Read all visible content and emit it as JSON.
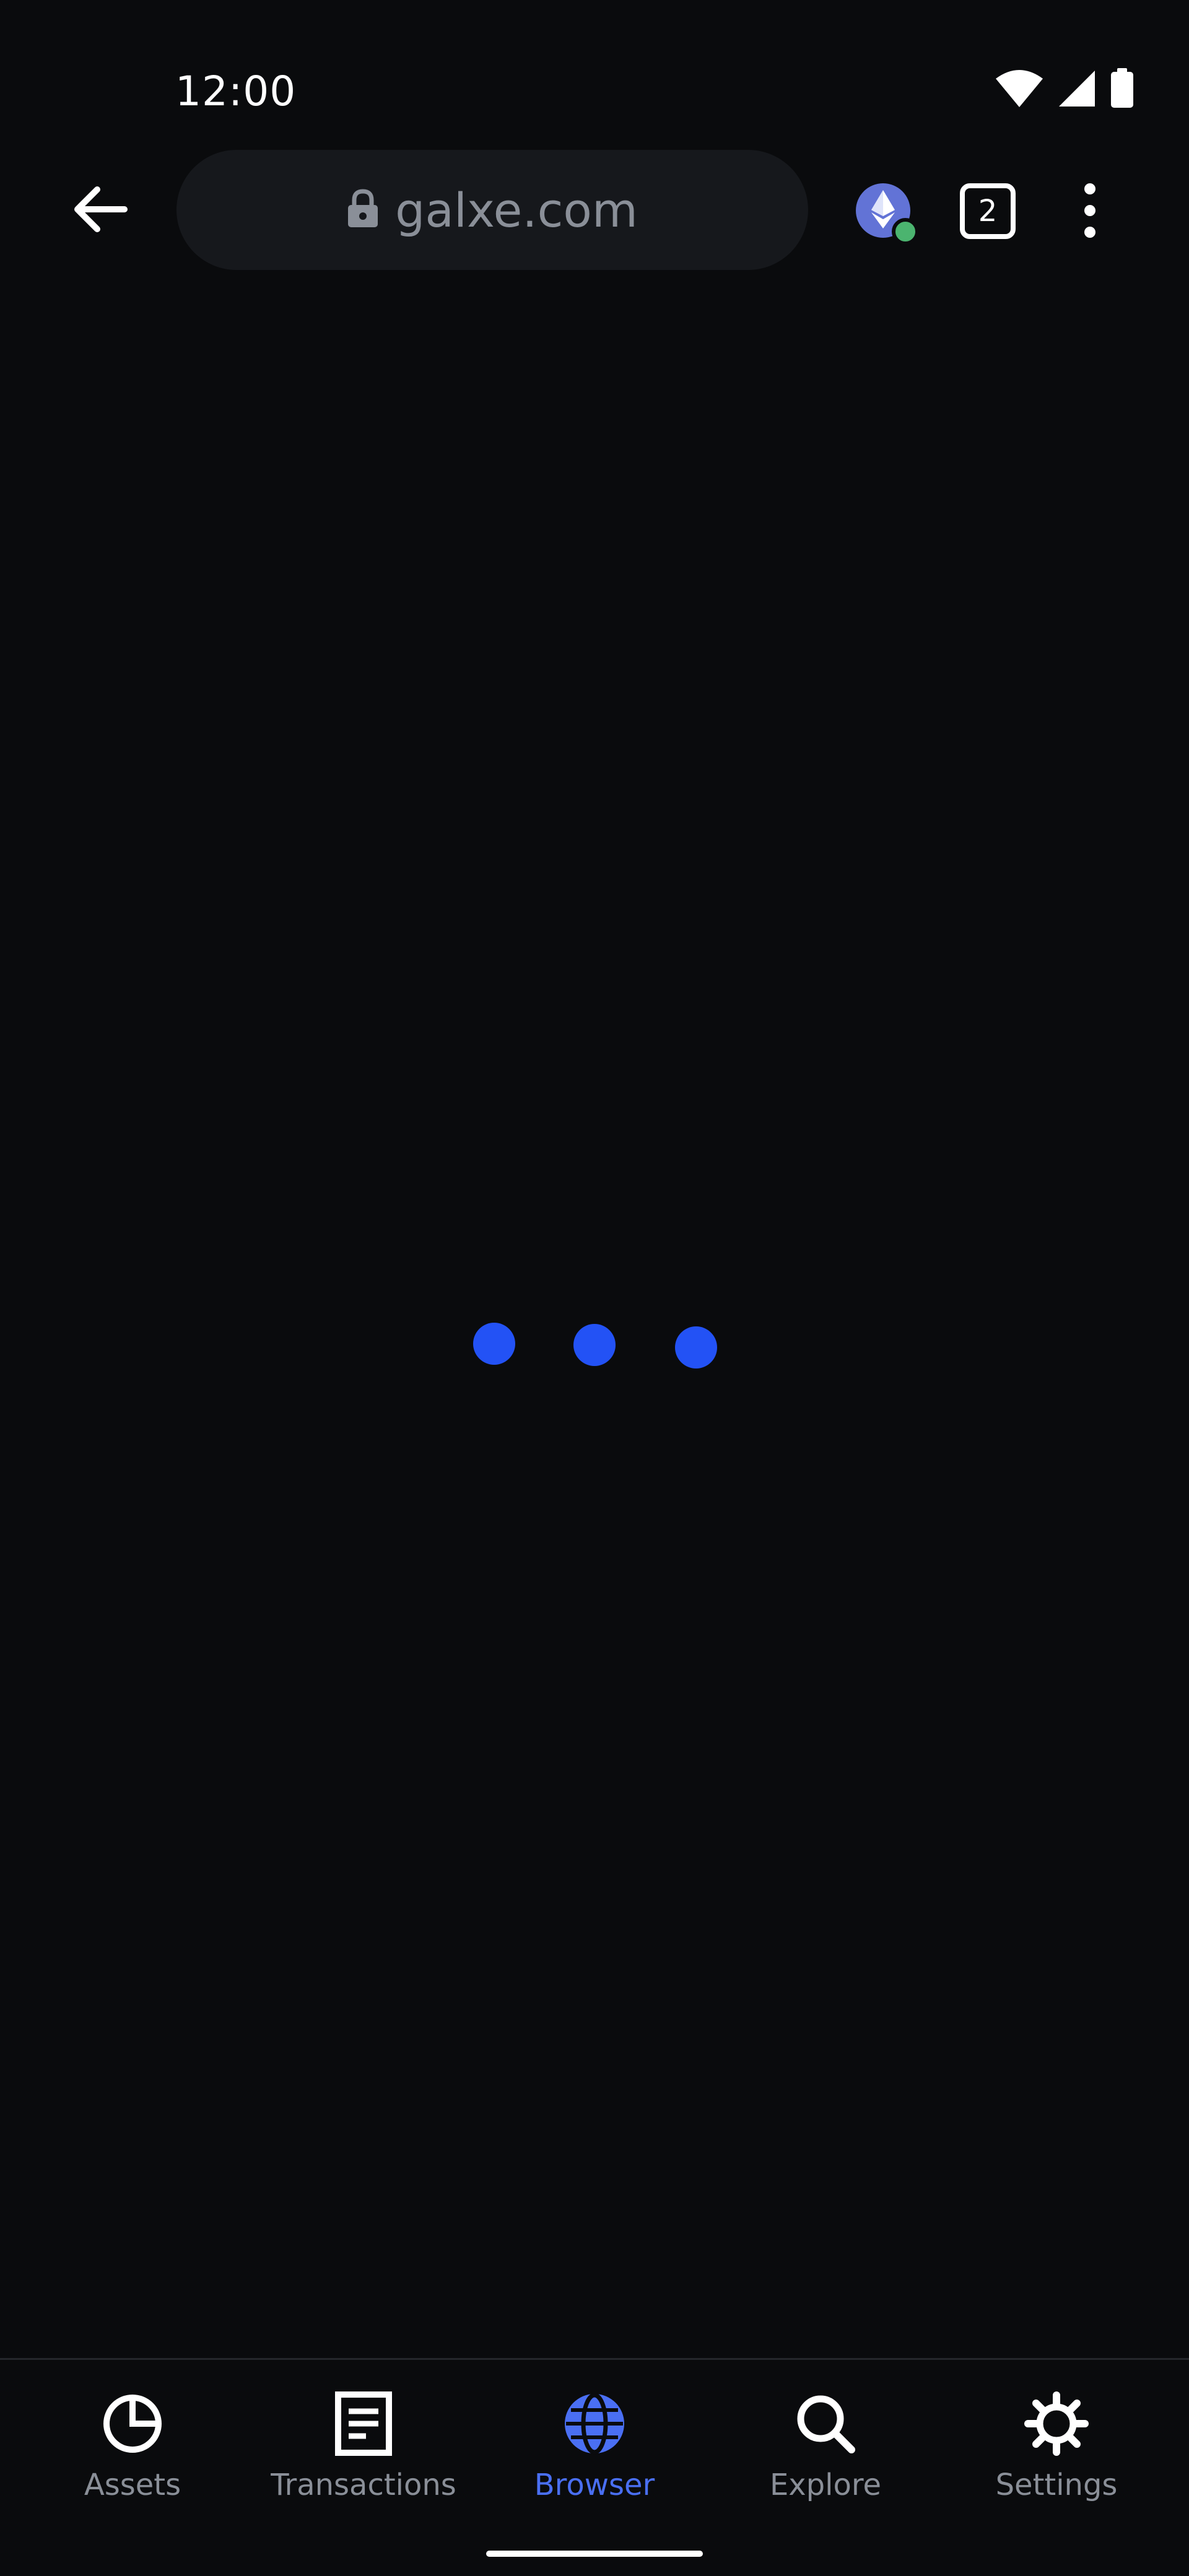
{
  "status_bar": {
    "time": "12:00",
    "icons": [
      "wifi-icon",
      "cellular-signal-icon",
      "battery-icon"
    ]
  },
  "toolbar": {
    "back_icon": "arrow-left-icon",
    "url": "galxe.com",
    "lock_icon": "lock-icon",
    "network_icon": "ethereum-icon",
    "network_status_color": "#4bb46f",
    "tab_count": "2",
    "menu_icon": "more-vert-icon"
  },
  "loader": {
    "dot_color": "#2352f5",
    "dot_count": 3
  },
  "bottom_nav": {
    "active_color": "#4a6ff3",
    "inactive_color": "#8a8f98",
    "items": [
      {
        "label": "Assets",
        "icon": "pie-chart-icon"
      },
      {
        "label": "Transactions",
        "icon": "document-icon"
      },
      {
        "label": "Browser",
        "icon": "globe-icon",
        "active": true
      },
      {
        "label": "Explore",
        "icon": "search-icon"
      },
      {
        "label": "Settings",
        "icon": "gear-icon"
      }
    ]
  }
}
